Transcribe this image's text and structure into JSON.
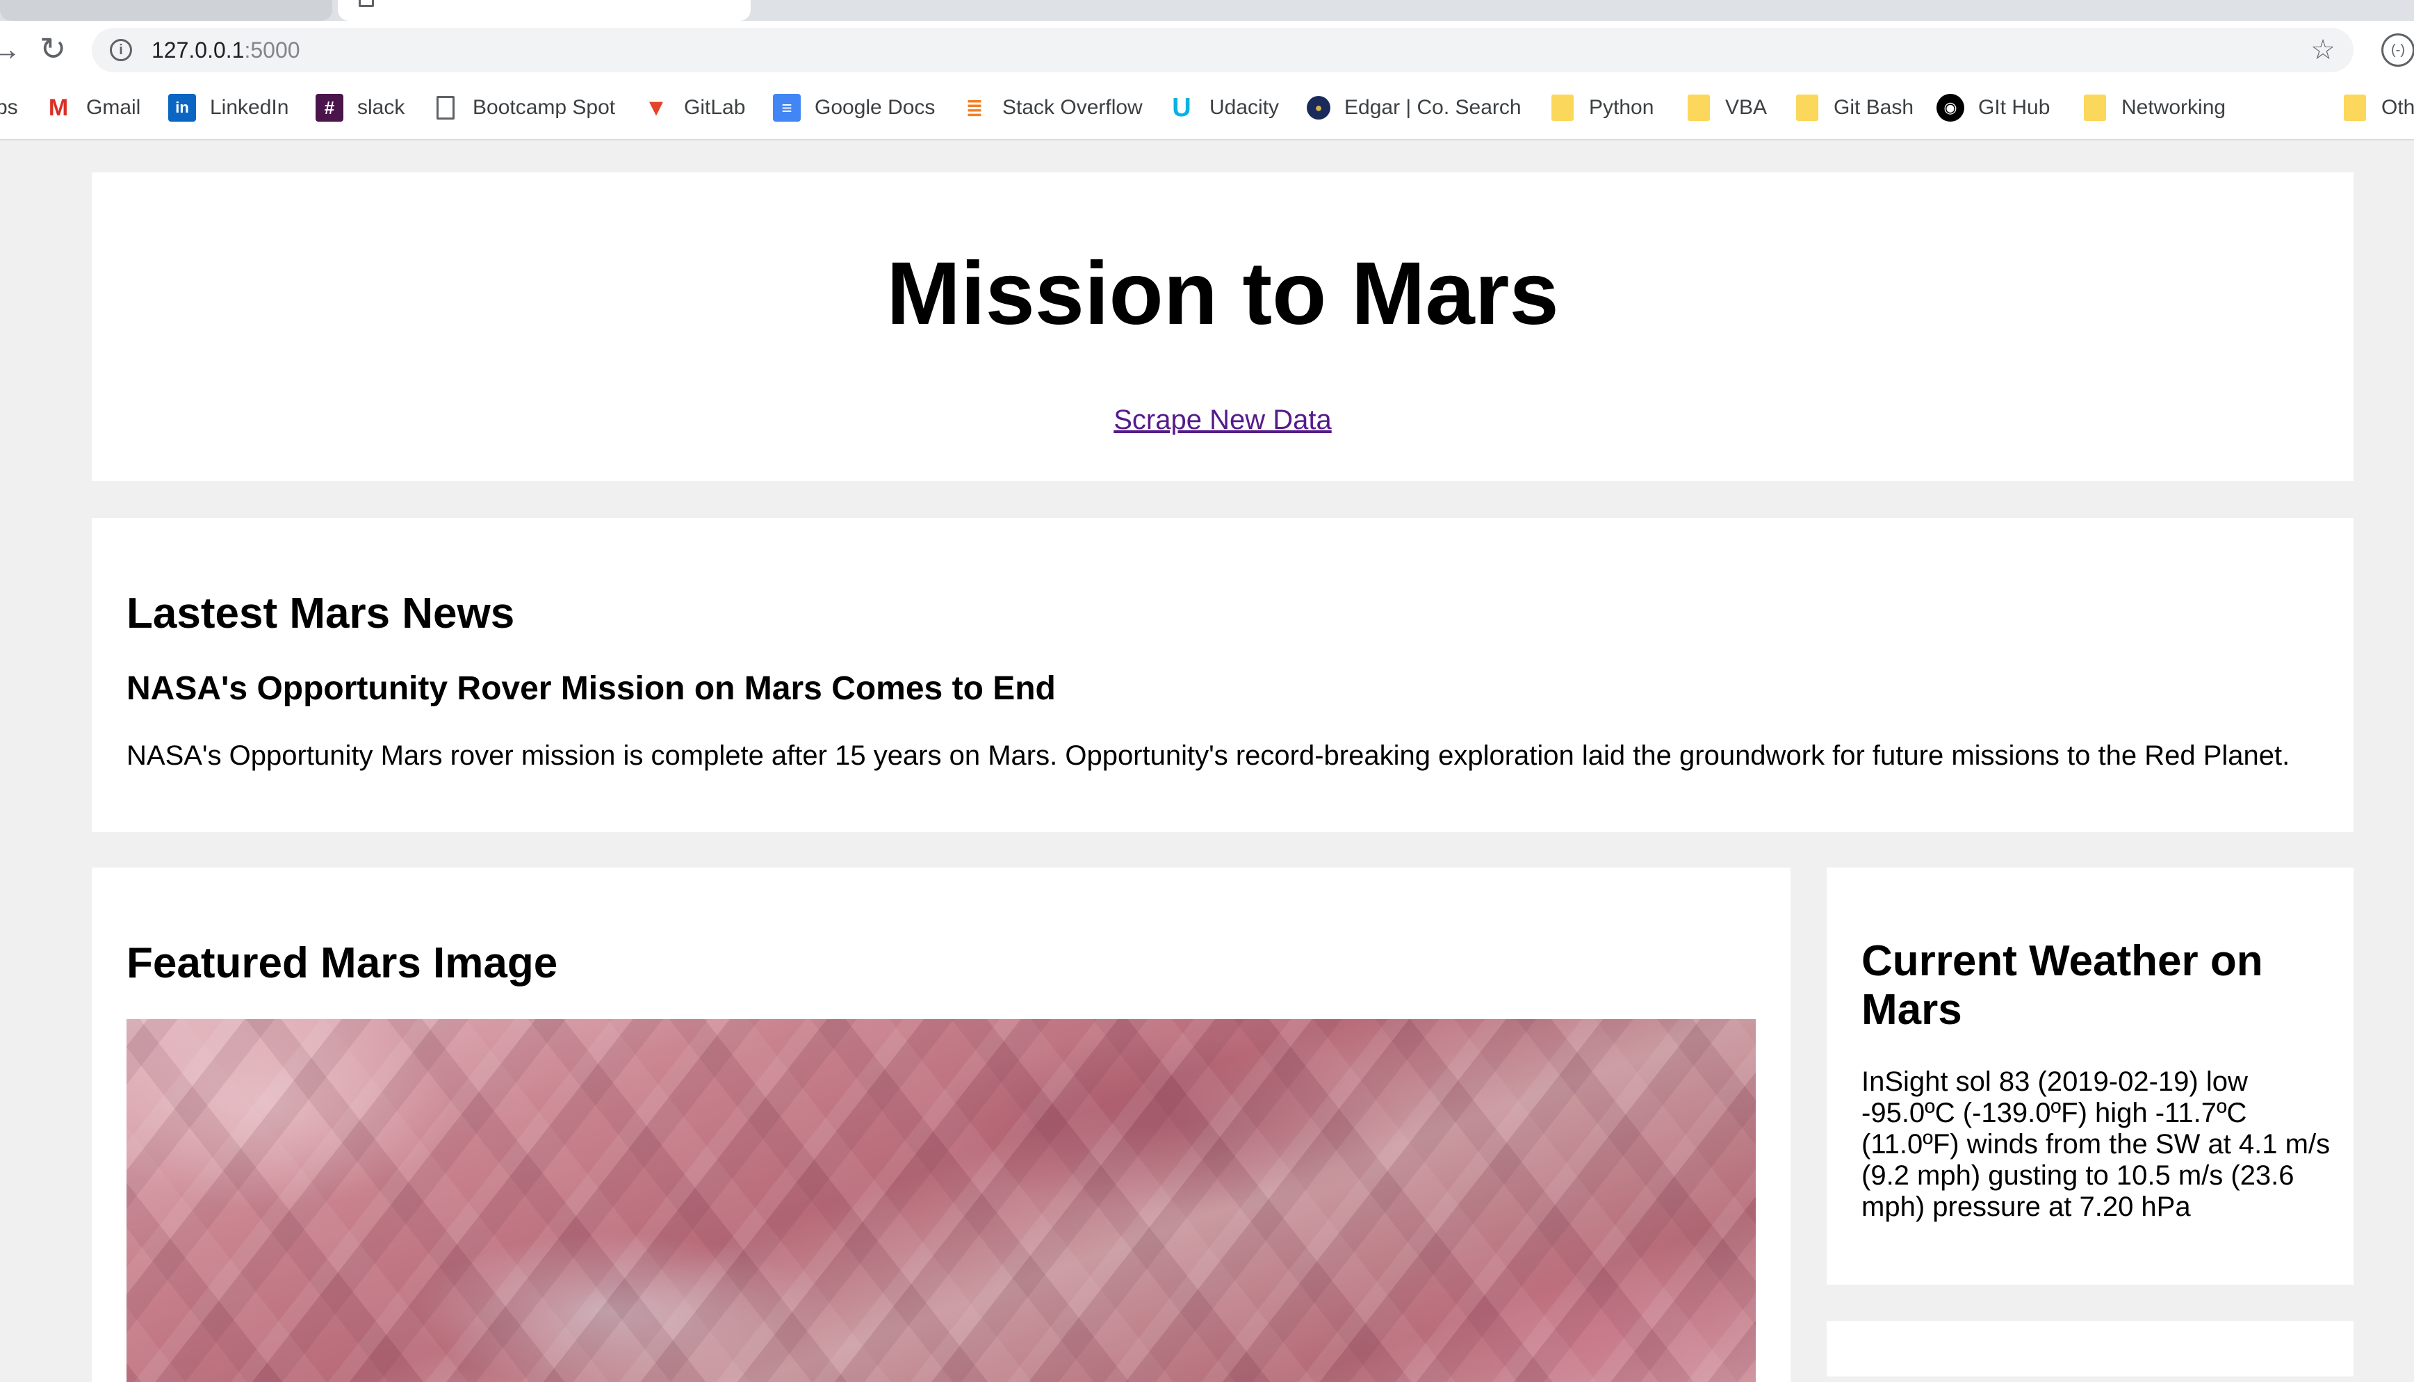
{
  "browser": {
    "url_host": "127.0.0.1",
    "url_port": ":5000",
    "bookmarks": [
      {
        "label": "ps",
        "icon": "apps-icon"
      },
      {
        "label": "Gmail",
        "icon": "gmail-icon",
        "color": "#d93025"
      },
      {
        "label": "LinkedIn",
        "icon": "linkedin-icon",
        "color": "#0a66c2"
      },
      {
        "label": "slack",
        "icon": "slack-icon",
        "color": "#4a154b"
      },
      {
        "label": "Bootcamp Spot",
        "icon": "page-icon"
      },
      {
        "label": "GitLab",
        "icon": "gitlab-icon",
        "color": "#e24329"
      },
      {
        "label": "Google Docs",
        "icon": "docs-icon",
        "color": "#4285f4"
      },
      {
        "label": "Stack Overflow",
        "icon": "stackoverflow-icon",
        "color": "#f48024"
      },
      {
        "label": "Udacity",
        "icon": "udacity-icon",
        "color": "#02b3e4"
      },
      {
        "label": "Edgar | Co. Search",
        "icon": "sec-seal-icon",
        "color": "#1a2a5a"
      },
      {
        "label": "Python",
        "icon": "folder-icon"
      },
      {
        "label": "VBA",
        "icon": "folder-icon"
      },
      {
        "label": "Git Bash",
        "icon": "folder-icon"
      },
      {
        "label": "GIt Hub",
        "icon": "github-icon",
        "color": "#000000"
      },
      {
        "label": "Networking",
        "icon": "folder-icon"
      },
      {
        "label": "Oth",
        "icon": "folder-icon"
      }
    ]
  },
  "jumbotron": {
    "title": "Mission to Mars",
    "scrape_link": "Scrape New Data"
  },
  "news": {
    "heading": "Lastest Mars News",
    "title": "NASA's Opportunity Rover Mission on Mars Comes to End",
    "paragraph": "NASA's Opportunity Mars rover mission is complete after 15 years on Mars. Opportunity's record-breaking exploration laid the groundwork for future missions to the Red Planet."
  },
  "featured": {
    "heading": "Featured Mars Image"
  },
  "weather": {
    "heading": "Current Weather on Mars",
    "report": "InSight sol 83 (2019-02-19) low -95.0ºC (-139.0ºF) high -11.7ºC (11.0ºF) winds from the SW at 4.1 m/s (9.2 mph) gusting to 10.5 m/s (23.6 mph) pressure at 7.20 hPa"
  }
}
